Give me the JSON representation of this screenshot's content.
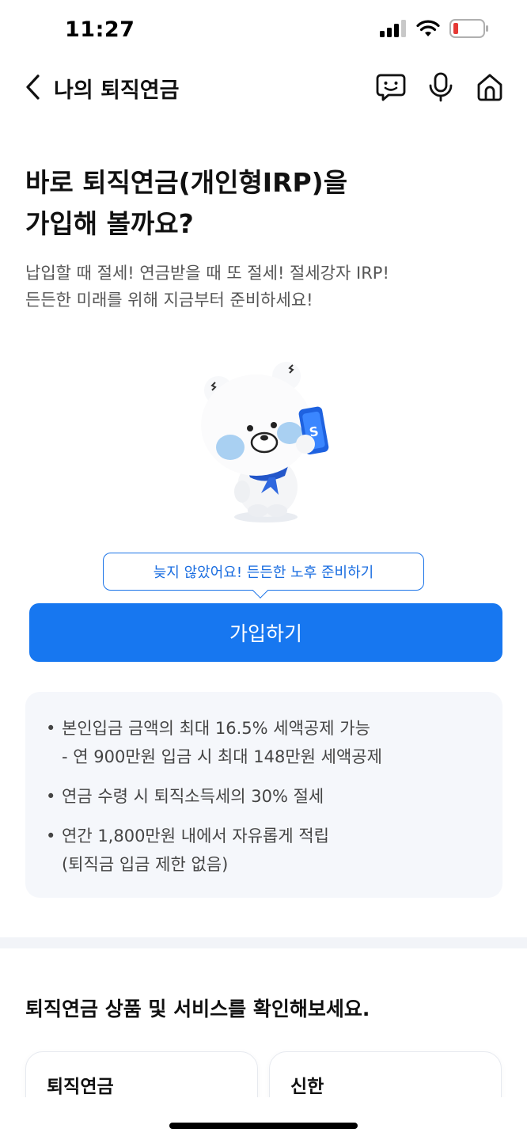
{
  "status": {
    "time": "11:27"
  },
  "nav": {
    "title": "나의 퇴직연금",
    "icons": [
      "back-arrow-icon",
      "chat-icon",
      "microphone-icon",
      "home-icon"
    ]
  },
  "hero": {
    "title_line1": "바로 퇴직연금(개인형IRP)을",
    "title_line2": "가입해 볼까요?",
    "desc_line1": "납입할 때 절세! 연금받을 때 또 절세! 절세강자 IRP!",
    "desc_line2": "든든한 미래를 위해 지금부터 준비하세요!"
  },
  "tooltip": {
    "text": "늦지 않았어요! 든든한 노후 준비하기"
  },
  "join_button": {
    "label": "가입하기"
  },
  "benefits": [
    {
      "bullet": "•",
      "line1": "본인입금 금액의 최대 16.5% 세액공제 가능",
      "line2": "- 연 900만원 입금 시 최대 148만원 세액공제"
    },
    {
      "bullet": "•",
      "line1": "연금 수령 시 퇴직소득세의 30% 절세",
      "line2": ""
    },
    {
      "bullet": "•",
      "line1": "연간 1,800만원 내에서 자유롭게 적립",
      "line2": "(퇴직금 입금 제한 없음)"
    }
  ],
  "services": {
    "title": "퇴직연금 상품 및 서비스를 확인해보세요.",
    "cards": [
      {
        "label": "퇴직연금"
      },
      {
        "label": "신한"
      }
    ]
  },
  "colors": {
    "accent": "#1777f0",
    "tooltip_border": "#1a73e8",
    "benefit_bg": "#f5f7fb",
    "battery_low": "#e53935"
  }
}
